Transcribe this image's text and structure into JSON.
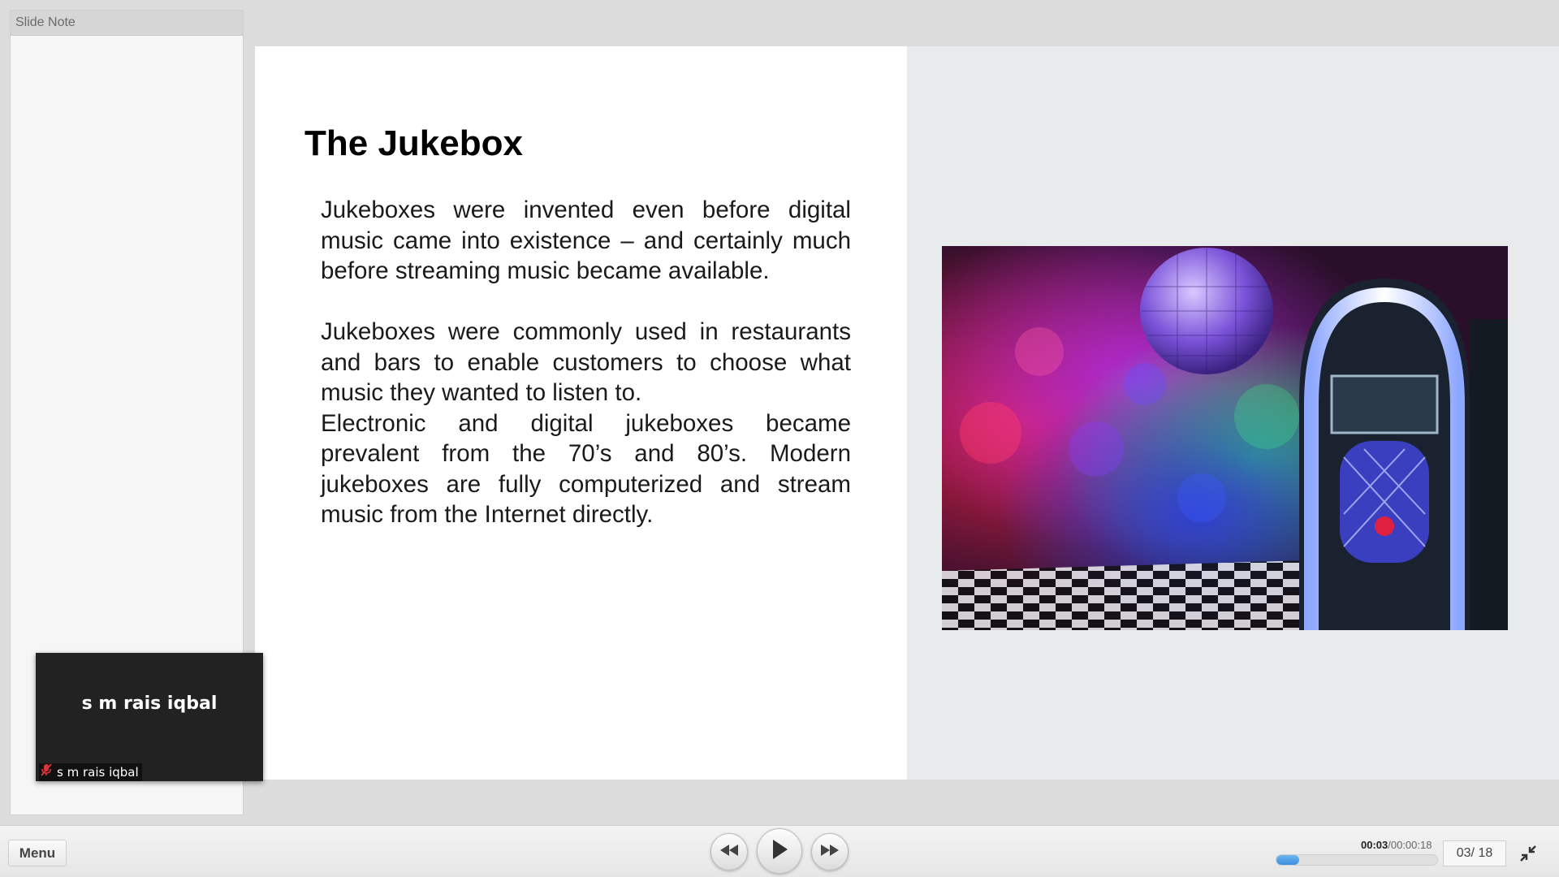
{
  "note_panel": {
    "header": "Slide Note"
  },
  "slide": {
    "title": "The Jukebox",
    "paragraphs": [
      "Jukeboxes were invented even before digital music came into existence – and certainly much before streaming music became available.",
      "Jukeboxes were commonly used in restaurants and bars to enable customers to choose what music they wanted to listen to.",
      "Electronic and digital jukeboxes became prevalent from the 70’s and 80’s. Modern jukeboxes are fully computerized and stream music from the Internet directly."
    ]
  },
  "presenter": {
    "name": "s m rais iqbal",
    "tag": "s m rais iqbal"
  },
  "toolbar": {
    "menu_label": "Menu",
    "time_current": "00:03",
    "time_total": "/00:00:18",
    "progress_fraction": 0.14,
    "page_indicator": "03/ 18"
  },
  "colors": {
    "progress": "#3c8fdd",
    "mute_icon": "#d9343b"
  },
  "icons": [
    "rewind-icon",
    "play-icon",
    "fast-forward-icon",
    "collapse-icon",
    "muted-mic-icon"
  ]
}
